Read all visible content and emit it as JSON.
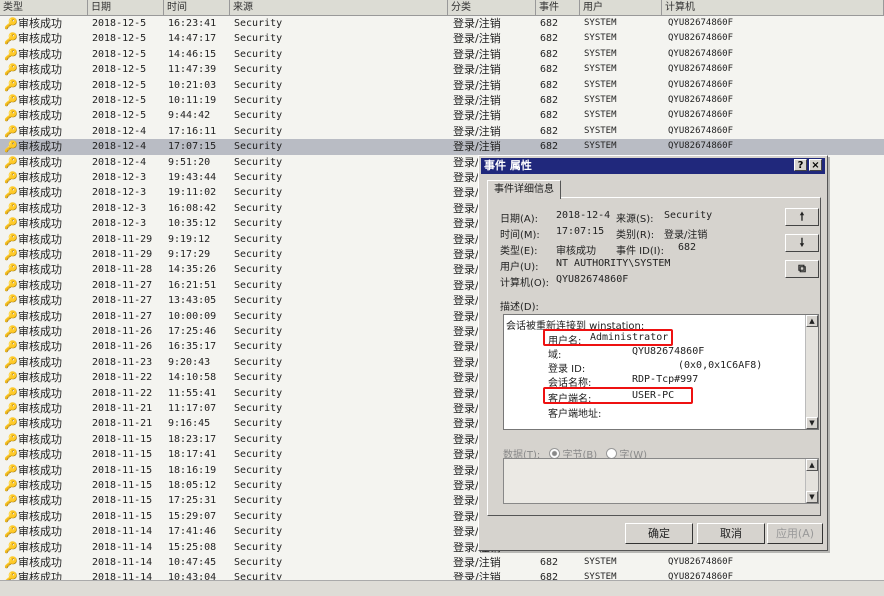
{
  "list": {
    "columns": [
      "类型",
      "日期",
      "时间",
      "来源",
      "分类",
      "事件",
      "用户",
      "计算机"
    ],
    "rows": [
      {
        "type": "审核成功",
        "date": "2018-12-5",
        "time": "16:23:41",
        "source": "Security",
        "cat": "登录/注销",
        "evt": "682",
        "user": "SYSTEM",
        "comp": "QYU82674860F"
      },
      {
        "type": "审核成功",
        "date": "2018-12-5",
        "time": "14:47:17",
        "source": "Security",
        "cat": "登录/注销",
        "evt": "682",
        "user": "SYSTEM",
        "comp": "QYU82674860F"
      },
      {
        "type": "审核成功",
        "date": "2018-12-5",
        "time": "14:46:15",
        "source": "Security",
        "cat": "登录/注销",
        "evt": "682",
        "user": "SYSTEM",
        "comp": "QYU82674860F"
      },
      {
        "type": "审核成功",
        "date": "2018-12-5",
        "time": "11:47:39",
        "source": "Security",
        "cat": "登录/注销",
        "evt": "682",
        "user": "SYSTEM",
        "comp": "QYU82674860F"
      },
      {
        "type": "审核成功",
        "date": "2018-12-5",
        "time": "10:21:03",
        "source": "Security",
        "cat": "登录/注销",
        "evt": "682",
        "user": "SYSTEM",
        "comp": "QYU82674860F"
      },
      {
        "type": "审核成功",
        "date": "2018-12-5",
        "time": "10:11:19",
        "source": "Security",
        "cat": "登录/注销",
        "evt": "682",
        "user": "SYSTEM",
        "comp": "QYU82674860F"
      },
      {
        "type": "审核成功",
        "date": "2018-12-5",
        "time": "9:44:42",
        "source": "Security",
        "cat": "登录/注销",
        "evt": "682",
        "user": "SYSTEM",
        "comp": "QYU82674860F"
      },
      {
        "type": "审核成功",
        "date": "2018-12-4",
        "time": "17:16:11",
        "source": "Security",
        "cat": "登录/注销",
        "evt": "682",
        "user": "SYSTEM",
        "comp": "QYU82674860F"
      },
      {
        "type": "审核成功",
        "date": "2018-12-4",
        "time": "17:07:15",
        "source": "Security",
        "cat": "登录/注销",
        "evt": "682",
        "user": "SYSTEM",
        "comp": "QYU82674860F",
        "selected": true
      },
      {
        "type": "审核成功",
        "date": "2018-12-4",
        "time": "9:51:20",
        "source": "Security",
        "cat": "登录/注销",
        "evt": "",
        "user": "",
        "comp": ""
      },
      {
        "type": "审核成功",
        "date": "2018-12-3",
        "time": "19:43:44",
        "source": "Security",
        "cat": "登录/注销",
        "evt": "",
        "user": "",
        "comp": ""
      },
      {
        "type": "审核成功",
        "date": "2018-12-3",
        "time": "19:11:02",
        "source": "Security",
        "cat": "登录/注销",
        "evt": "",
        "user": "",
        "comp": ""
      },
      {
        "type": "审核成功",
        "date": "2018-12-3",
        "time": "16:08:42",
        "source": "Security",
        "cat": "登录/注销",
        "evt": "",
        "user": "",
        "comp": ""
      },
      {
        "type": "审核成功",
        "date": "2018-12-3",
        "time": "10:35:12",
        "source": "Security",
        "cat": "登录/注销",
        "evt": "",
        "user": "",
        "comp": ""
      },
      {
        "type": "审核成功",
        "date": "2018-11-29",
        "time": "9:19:12",
        "source": "Security",
        "cat": "登录/注销",
        "evt": "",
        "user": "",
        "comp": ""
      },
      {
        "type": "审核成功",
        "date": "2018-11-29",
        "time": "9:17:29",
        "source": "Security",
        "cat": "登录/注销",
        "evt": "",
        "user": "",
        "comp": ""
      },
      {
        "type": "审核成功",
        "date": "2018-11-28",
        "time": "14:35:26",
        "source": "Security",
        "cat": "登录/注销",
        "evt": "",
        "user": "",
        "comp": ""
      },
      {
        "type": "审核成功",
        "date": "2018-11-27",
        "time": "16:21:51",
        "source": "Security",
        "cat": "登录/注销",
        "evt": "",
        "user": "",
        "comp": ""
      },
      {
        "type": "审核成功",
        "date": "2018-11-27",
        "time": "13:43:05",
        "source": "Security",
        "cat": "登录/注销",
        "evt": "",
        "user": "",
        "comp": ""
      },
      {
        "type": "审核成功",
        "date": "2018-11-27",
        "time": "10:00:09",
        "source": "Security",
        "cat": "登录/注销",
        "evt": "",
        "user": "",
        "comp": ""
      },
      {
        "type": "审核成功",
        "date": "2018-11-26",
        "time": "17:25:46",
        "source": "Security",
        "cat": "登录/注销",
        "evt": "",
        "user": "",
        "comp": ""
      },
      {
        "type": "审核成功",
        "date": "2018-11-26",
        "time": "16:35:17",
        "source": "Security",
        "cat": "登录/注销",
        "evt": "",
        "user": "",
        "comp": ""
      },
      {
        "type": "审核成功",
        "date": "2018-11-23",
        "time": "9:20:43",
        "source": "Security",
        "cat": "登录/注销",
        "evt": "",
        "user": "",
        "comp": ""
      },
      {
        "type": "审核成功",
        "date": "2018-11-22",
        "time": "14:10:58",
        "source": "Security",
        "cat": "登录/注销",
        "evt": "",
        "user": "",
        "comp": ""
      },
      {
        "type": "审核成功",
        "date": "2018-11-22",
        "time": "11:55:41",
        "source": "Security",
        "cat": "登录/注销",
        "evt": "",
        "user": "",
        "comp": ""
      },
      {
        "type": "审核成功",
        "date": "2018-11-21",
        "time": "11:17:07",
        "source": "Security",
        "cat": "登录/注销",
        "evt": "",
        "user": "",
        "comp": ""
      },
      {
        "type": "审核成功",
        "date": "2018-11-21",
        "time": "9:16:45",
        "source": "Security",
        "cat": "登录/注销",
        "evt": "",
        "user": "",
        "comp": ""
      },
      {
        "type": "审核成功",
        "date": "2018-11-15",
        "time": "18:23:17",
        "source": "Security",
        "cat": "登录/注销",
        "evt": "",
        "user": "",
        "comp": ""
      },
      {
        "type": "审核成功",
        "date": "2018-11-15",
        "time": "18:17:41",
        "source": "Security",
        "cat": "登录/注销",
        "evt": "",
        "user": "",
        "comp": ""
      },
      {
        "type": "审核成功",
        "date": "2018-11-15",
        "time": "18:16:19",
        "source": "Security",
        "cat": "登录/注销",
        "evt": "",
        "user": "",
        "comp": ""
      },
      {
        "type": "审核成功",
        "date": "2018-11-15",
        "time": "18:05:12",
        "source": "Security",
        "cat": "登录/注销",
        "evt": "",
        "user": "",
        "comp": ""
      },
      {
        "type": "审核成功",
        "date": "2018-11-15",
        "time": "17:25:31",
        "source": "Security",
        "cat": "登录/注销",
        "evt": "",
        "user": "",
        "comp": ""
      },
      {
        "type": "审核成功",
        "date": "2018-11-15",
        "time": "15:29:07",
        "source": "Security",
        "cat": "登录/注销",
        "evt": "",
        "user": "",
        "comp": ""
      },
      {
        "type": "审核成功",
        "date": "2018-11-14",
        "time": "17:41:46",
        "source": "Security",
        "cat": "登录/注销",
        "evt": "",
        "user": "",
        "comp": ""
      },
      {
        "type": "审核成功",
        "date": "2018-11-14",
        "time": "15:25:08",
        "source": "Security",
        "cat": "登录/注销",
        "evt": "682",
        "user": "SYSTEM",
        "comp": "QYU82674860F"
      },
      {
        "type": "审核成功",
        "date": "2018-11-14",
        "time": "10:47:45",
        "source": "Security",
        "cat": "登录/注销",
        "evt": "682",
        "user": "SYSTEM",
        "comp": "QYU82674860F"
      },
      {
        "type": "审核成功",
        "date": "2018-11-14",
        "time": "10:43:04",
        "source": "Security",
        "cat": "登录/注销",
        "evt": "682",
        "user": "SYSTEM",
        "comp": "QYU82674860F"
      }
    ]
  },
  "dialog": {
    "title": "事件 属性",
    "help_label": "?",
    "close_label": "×",
    "tab": "事件详细信息",
    "fields": {
      "date_label": "日期(A):",
      "date": "2018-12-4",
      "source_label": "来源(S):",
      "source": "Security",
      "time_label": "时间(M):",
      "time": "17:07:15",
      "category_label": "类别(R):",
      "category": "登录/注销",
      "type_label": "类型(E):",
      "type": "审核成功",
      "event_id_label": "事件 ID(I):",
      "event_id": "682",
      "user_label": "用户(U):",
      "user": "NT AUTHORITY\\SYSTEM",
      "computer_label": "计算机(O):",
      "computer": "QYU82674860F"
    },
    "buttons": {
      "up": "🠕",
      "down": "🠗",
      "copy": "⧉"
    },
    "description_label": "描述(D):",
    "description": {
      "line0": "会话被重新连接到 winstation:",
      "user_name_label": "用户名:",
      "user_name": "Administrator",
      "domain_label": "域:",
      "domain": "QYU82674860F",
      "logon_id_label": "登录 ID:",
      "logon_id": "(0x0,0x1C6AF8)",
      "session_label": "会话名称:",
      "session": "RDP-Tcp#997",
      "client_name_label": "客户端名:",
      "client_name": "USER-PC",
      "client_addr_label": "客户端地址:",
      "client_addr": ""
    },
    "data": {
      "label": "数据(T):",
      "bytes": "字节(B)",
      "words": "字(W)"
    },
    "ok": "确定",
    "cancel": "取消",
    "apply": "应用(A)"
  },
  "colors": {
    "titlebar": "#20287c",
    "highlight": "#e11111",
    "selected_row": "#b9bcc4"
  }
}
